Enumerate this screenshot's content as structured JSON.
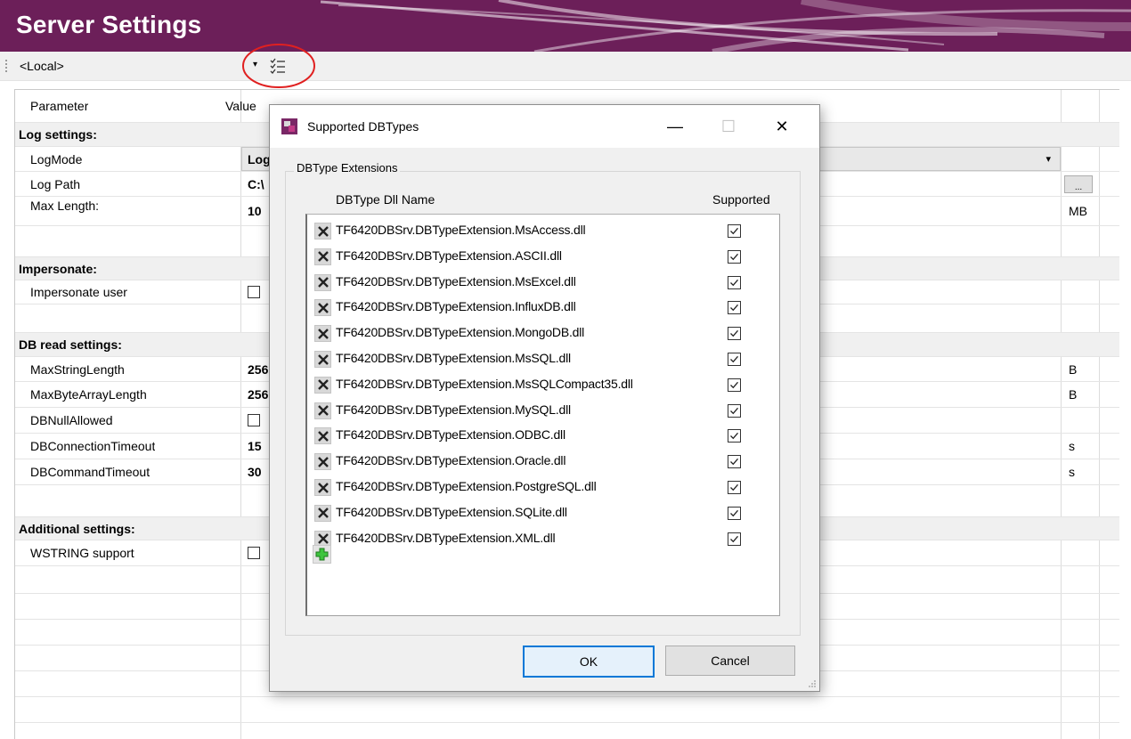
{
  "header": {
    "title": "Server Settings",
    "color": "#6c1f59"
  },
  "toolbar": {
    "server_value": "<Local>",
    "dropdown_glyph": "▾",
    "list_icon": "checklist-icon"
  },
  "grid": {
    "col_param": "Parameter",
    "col_value": "Value",
    "rows": [
      {
        "type": "section",
        "name": "Log settings:"
      },
      {
        "type": "param",
        "name": "LogMode",
        "value": "Log",
        "unit": ""
      },
      {
        "type": "param",
        "name": "Log Path",
        "value": "C:\\",
        "unit": ""
      },
      {
        "type": "param",
        "name": " Max Length:",
        "value": "10",
        "unit": "MB"
      },
      {
        "type": "blank"
      },
      {
        "type": "section",
        "name": "Impersonate:"
      },
      {
        "type": "param",
        "name": "Impersonate user",
        "value": "",
        "unit": ""
      },
      {
        "type": "blank"
      },
      {
        "type": "section",
        "name": "DB read settings:"
      },
      {
        "type": "param",
        "name": "MaxStringLength",
        "value": "256",
        "unit": "B"
      },
      {
        "type": "param",
        "name": "MaxByteArrayLength",
        "value": "256",
        "unit": "B"
      },
      {
        "type": "param",
        "name": "DBNullAllowed",
        "value": "",
        "unit": ""
      },
      {
        "type": "param",
        "name": "DBConnectionTimeout",
        "value": "15",
        "unit": "s"
      },
      {
        "type": "param",
        "name": "DBCommandTimeout",
        "value": "30",
        "unit": "s"
      },
      {
        "type": "blank"
      },
      {
        "type": "section",
        "name": "Additional settings:"
      },
      {
        "type": "param",
        "name": "WSTRING support",
        "value": "",
        "unit": ""
      }
    ],
    "browse_button": "..."
  },
  "dialog": {
    "title": "Supported DBTypes",
    "group_label": "DBType Extensions",
    "col_name": "DBType Dll Name",
    "col_supported": "Supported",
    "extensions": [
      {
        "name": "TF6420DBSrv.DBTypeExtension.MsAccess.dll",
        "supported": true
      },
      {
        "name": "TF6420DBSrv.DBTypeExtension.ASCII.dll",
        "supported": true
      },
      {
        "name": "TF6420DBSrv.DBTypeExtension.MsExcel.dll",
        "supported": true
      },
      {
        "name": "TF6420DBSrv.DBTypeExtension.InfluxDB.dll",
        "supported": true
      },
      {
        "name": "TF6420DBSrv.DBTypeExtension.MongoDB.dll",
        "supported": true
      },
      {
        "name": "TF6420DBSrv.DBTypeExtension.MsSQL.dll",
        "supported": true
      },
      {
        "name": "TF6420DBSrv.DBTypeExtension.MsSQLCompact35.dll",
        "supported": true
      },
      {
        "name": "TF6420DBSrv.DBTypeExtension.MySQL.dll",
        "supported": true
      },
      {
        "name": "TF6420DBSrv.DBTypeExtension.ODBC.dll",
        "supported": true
      },
      {
        "name": "TF6420DBSrv.DBTypeExtension.Oracle.dll",
        "supported": true
      },
      {
        "name": "TF6420DBSrv.DBTypeExtension.PostgreSQL.dll",
        "supported": true
      },
      {
        "name": "TF6420DBSrv.DBTypeExtension.SQLite.dll",
        "supported": true
      },
      {
        "name": "TF6420DBSrv.DBTypeExtension.XML.dll",
        "supported": true
      }
    ],
    "ok_label": "OK",
    "cancel_label": "Cancel",
    "minimize_glyph": "—",
    "maximize_glyph": "☐",
    "close_glyph": "✕"
  }
}
